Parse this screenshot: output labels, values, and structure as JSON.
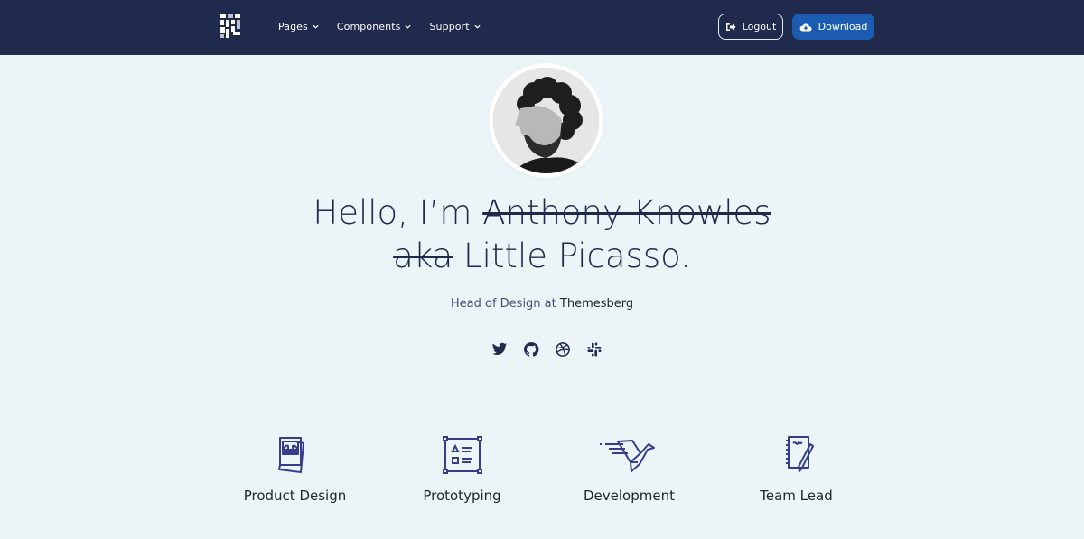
{
  "navbar": {
    "logo": "brand-logo",
    "links": [
      {
        "label": "Pages",
        "icon": "chevron-down-icon"
      },
      {
        "label": "Components",
        "icon": "chevron-down-icon"
      },
      {
        "label": "Support",
        "icon": "chevron-down-icon"
      }
    ],
    "logout": {
      "label": "Logout",
      "icon": "sign-out-icon"
    },
    "download": {
      "label": "Download",
      "icon": "cloud-download-icon"
    }
  },
  "profile": {
    "avatar": "profile-photo",
    "headline": {
      "prefix": "Hello, I’m",
      "struck_name": "Anthony Knowles",
      "struck_aka": "aka",
      "nickname": "Little Picasso."
    },
    "subtitle": {
      "role": "Head of Design at",
      "company": "Themesberg"
    },
    "social": [
      {
        "name": "twitter-icon"
      },
      {
        "name": "github-icon"
      },
      {
        "name": "dribbble-icon"
      },
      {
        "name": "slack-icon"
      }
    ]
  },
  "services": [
    {
      "label": "Product Design",
      "icon": "photos-icon"
    },
    {
      "label": "Prototyping",
      "icon": "wireframe-icon"
    },
    {
      "label": "Development",
      "icon": "origami-bird-icon"
    },
    {
      "label": "Team Lead",
      "icon": "notebook-pencil-icon"
    }
  ],
  "colors": {
    "navbar_bg": "#1f2a4d",
    "page_bg": "#ebf4f7",
    "download_btn": "#1c5cb0",
    "icon_stroke": "#373d8c"
  }
}
